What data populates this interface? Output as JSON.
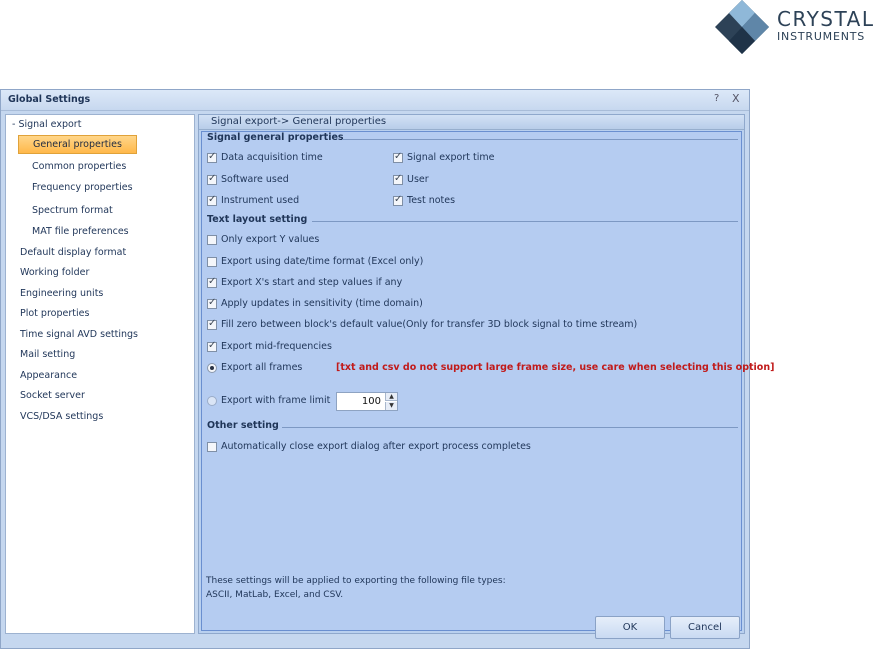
{
  "logo": {
    "line1": "CRYSTAL",
    "line2": "INSTRUMENTS",
    "colors": {
      "dark": "#2d4257",
      "light": "#8fb8d8"
    }
  },
  "dialog": {
    "title": "Global Settings",
    "help_glyph": "?",
    "close_glyph": "X"
  },
  "tree": {
    "items": [
      {
        "label": "- Signal export"
      },
      {
        "label": "General properties",
        "selected": true
      },
      {
        "label": "Common properties"
      },
      {
        "label": "Frequency properties"
      },
      {
        "label": "Spectrum format"
      },
      {
        "label": "MAT file preferences"
      },
      {
        "label": "Default display format"
      },
      {
        "label": "Working folder"
      },
      {
        "label": "Engineering units"
      },
      {
        "label": "Plot properties"
      },
      {
        "label": "Time signal AVD settings"
      },
      {
        "label": "Mail setting"
      },
      {
        "label": "Appearance"
      },
      {
        "label": "Socket server"
      },
      {
        "label": "VCS/DSA settings"
      }
    ]
  },
  "panel": {
    "header": "Signal export-> General properties",
    "groups": {
      "general": "Signal general properties",
      "text_layout": "Text layout setting",
      "other": "Other setting"
    },
    "general_options": [
      {
        "label": "Data acquisition time",
        "checked": true
      },
      {
        "label": "Signal export time",
        "checked": true
      },
      {
        "label": "Software used",
        "checked": true
      },
      {
        "label": "User",
        "checked": true
      },
      {
        "label": "Instrument used",
        "checked": true
      },
      {
        "label": "Test notes",
        "checked": true
      }
    ],
    "layout_options": [
      {
        "label": "Only export Y values",
        "checked": false
      },
      {
        "label": "Export using date/time format (Excel only)",
        "checked": false
      },
      {
        "label": "Export X's start and step values if any",
        "checked": true
      },
      {
        "label": "Apply updates in sensitivity (time domain)",
        "checked": true
      },
      {
        "label": "Fill zero between block's default value(Only for transfer 3D block signal to time stream)",
        "checked": true
      },
      {
        "label": "Export mid-frequencies",
        "checked": true
      }
    ],
    "radio_all": {
      "label": "Export all frames",
      "selected": true
    },
    "warning": "[txt and csv do not support large frame size, use care when selecting this option]",
    "radio_limit": {
      "label": "Export with frame limit",
      "selected": false
    },
    "frame_limit_value": "100",
    "other_options": [
      {
        "label": "Automatically close export dialog after export process completes",
        "checked": false
      }
    ],
    "note_line1": "These settings will be applied to exporting the following file types:",
    "note_line2": "ASCII, MatLab, Excel, and CSV."
  },
  "buttons": {
    "ok": "OK",
    "cancel": "Cancel"
  }
}
